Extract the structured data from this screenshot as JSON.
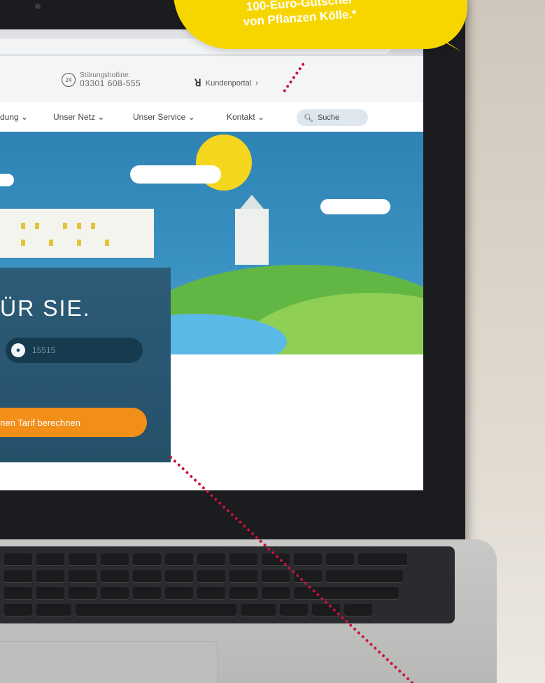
{
  "promo": {
    "line1": "100-Euro-Gutschei",
    "line2": "von Pflanzen Kölle.*"
  },
  "browser": {
    "star_icon": "star-icon",
    "profile_icon": "profile-icon",
    "menu_icon": "kebab-menu-icon"
  },
  "site": {
    "hotline_label": "Störungshotline:",
    "hotline_number": "03301 608-555",
    "hotline_icon": "24h-icon",
    "portal_label": "Kundenportal",
    "portal_chevron": "›",
    "nav": [
      "dung ⌄",
      "Unser Netz ⌄",
      "Unser Service ⌄",
      "Kontakt ⌄"
    ],
    "search_label": "Suche"
  },
  "hero": {
    "title": "ÜR SIE.",
    "plz_placeholder": "15515",
    "cta_label": "einen Tarif berechnen"
  },
  "colors": {
    "accent_orange": "#f28f18",
    "panel_blue": "#2d5c78",
    "promo_yellow": "#f7d600",
    "dotted_line": "#c8123a"
  }
}
